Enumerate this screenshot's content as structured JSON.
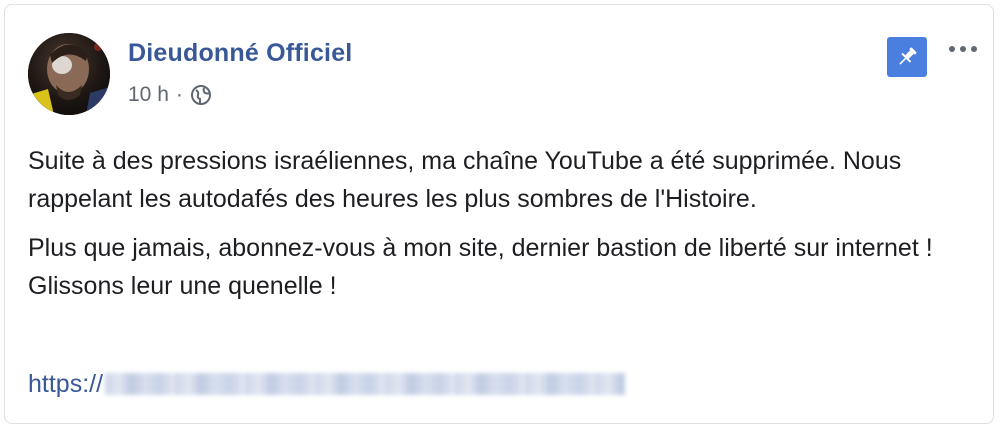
{
  "post": {
    "author_name": "Dieudonné Officiel",
    "time": "10 h",
    "separator": "·",
    "privacy_icon": "globe-icon",
    "actions": {
      "pin_icon": "pin-icon",
      "more_icon": "more-horizontal-icon"
    },
    "paragraphs": [
      "Suite à des pressions israéliennes, ma chaîne YouTube a été supprimée. Nous rappelant les autodafés des heures les plus sombres de l'Histoire.",
      "Plus que jamais, abonnez-vous à mon site, dernier bastion de liberté sur internet ! Glissons leur une quenelle !"
    ],
    "link_prefix": "https://"
  },
  "colors": {
    "author_link": "#385898",
    "meta_text": "#606770",
    "pin_button_bg": "#4a7fe0",
    "body_text": "#1c1e21",
    "card_border": "#dddfe2"
  }
}
